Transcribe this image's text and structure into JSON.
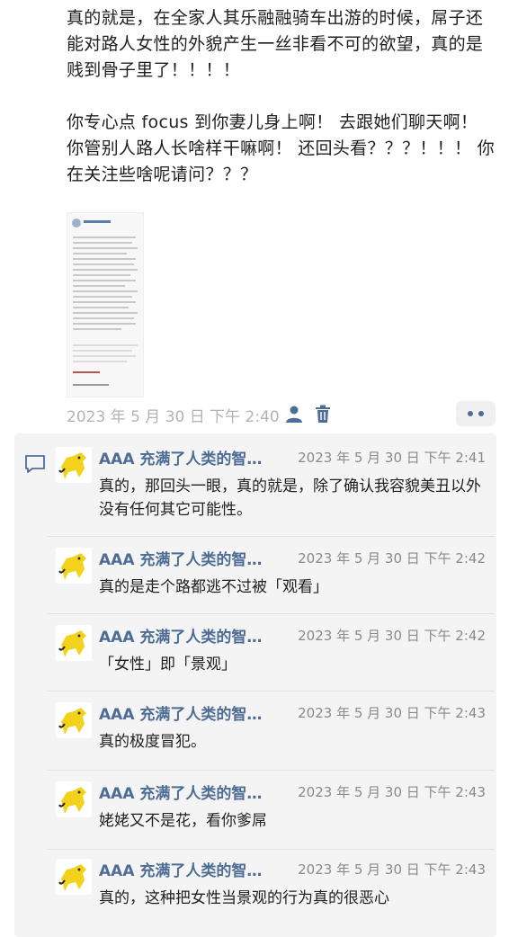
{
  "post": {
    "text": "真的就是，在全家人其乐融融骑车出游的时候，屌子还能对路人女性的外貌产生一丝非看不可的欲望，真的是贱到骨子里了！！！！\n\n你专心点 focus 到你妻儿身上啊！ 去跟她们聊天啊！ 你管别人路人长啥样干嘛啊！ 还回头看？？？！！！ 你在关注些啥呢请问？？？",
    "timestamp": "2023 年 5 月 30 日  下午 2:40"
  },
  "icons": {
    "person": "person-icon",
    "trash": "trash-icon",
    "more": "more-dots-icon",
    "comment": "comment-bubble-icon"
  },
  "colors": {
    "link": "#4e6d94",
    "avatar_yellow": "#f2d21b"
  },
  "comments": [
    {
      "author": "AAA 充满了人类的智…",
      "time": "2023 年 5 月 30 日  下午 2:41",
      "text": "真的，那回头一眼，真的就是，除了确认我容貌美丑以外没有任何其它可能性。"
    },
    {
      "author": "AAA 充满了人类的智…",
      "time": "2023 年 5 月 30 日  下午 2:42",
      "text": "真的是走个路都逃不过被「观看」"
    },
    {
      "author": "AAA 充满了人类的智…",
      "time": "2023 年 5 月 30 日  下午 2:42",
      "text": "「女性」即「景观」"
    },
    {
      "author": "AAA 充满了人类的智…",
      "time": "2023 年 5 月 30 日  下午 2:43",
      "text": "真的极度冒犯。"
    },
    {
      "author": "AAA 充满了人类的智…",
      "time": "2023 年 5 月 30 日  下午 2:43",
      "text": "姥姥又不是花，看你爹屌"
    },
    {
      "author": "AAA 充满了人类的智…",
      "time": "2023 年 5 月 30 日  下午 2:43",
      "text": "真的，这种把女性当景观的行为真的很恶心"
    }
  ]
}
